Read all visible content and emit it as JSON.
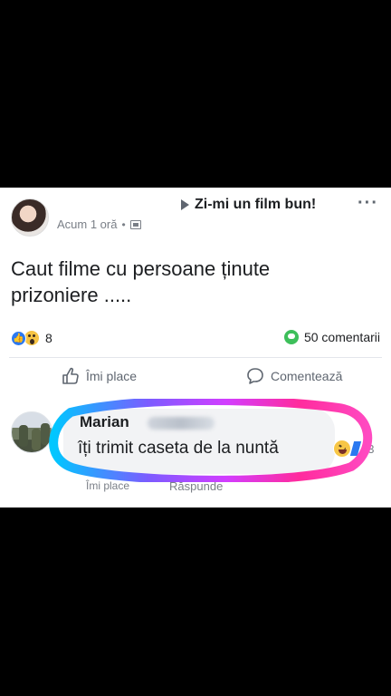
{
  "post": {
    "title": "Zi-mi un film bun!",
    "timestamp": "Acum 1 oră",
    "separator": "•",
    "body": "Caut filme cu persoane ținute prizoniere .....",
    "reactions_count": "8",
    "comments_count": "50 comentarii"
  },
  "actions": {
    "like": "Îmi place",
    "comment": "Comentează"
  },
  "comment": {
    "author": "Marian",
    "text": "îți trimit caseta de la nuntă",
    "reaction_count": "23",
    "links": [
      "Îmi place",
      "Răspunde"
    ]
  },
  "icons": {
    "more": "more-icon",
    "like": "like-icon",
    "comment": "comment-icon",
    "reaction_like": "reaction-like-icon",
    "reaction_wow": "reaction-wow-icon",
    "comment_badge": "comment-badge-icon",
    "reaction_haha": "haha-icon"
  },
  "colors": {
    "background": "#000000",
    "card": "#ffffff",
    "text": "#1c1e21",
    "muted": "#7a7f87",
    "facebook_blue": "#2b79f0",
    "comment_green": "#3dbf5a"
  }
}
